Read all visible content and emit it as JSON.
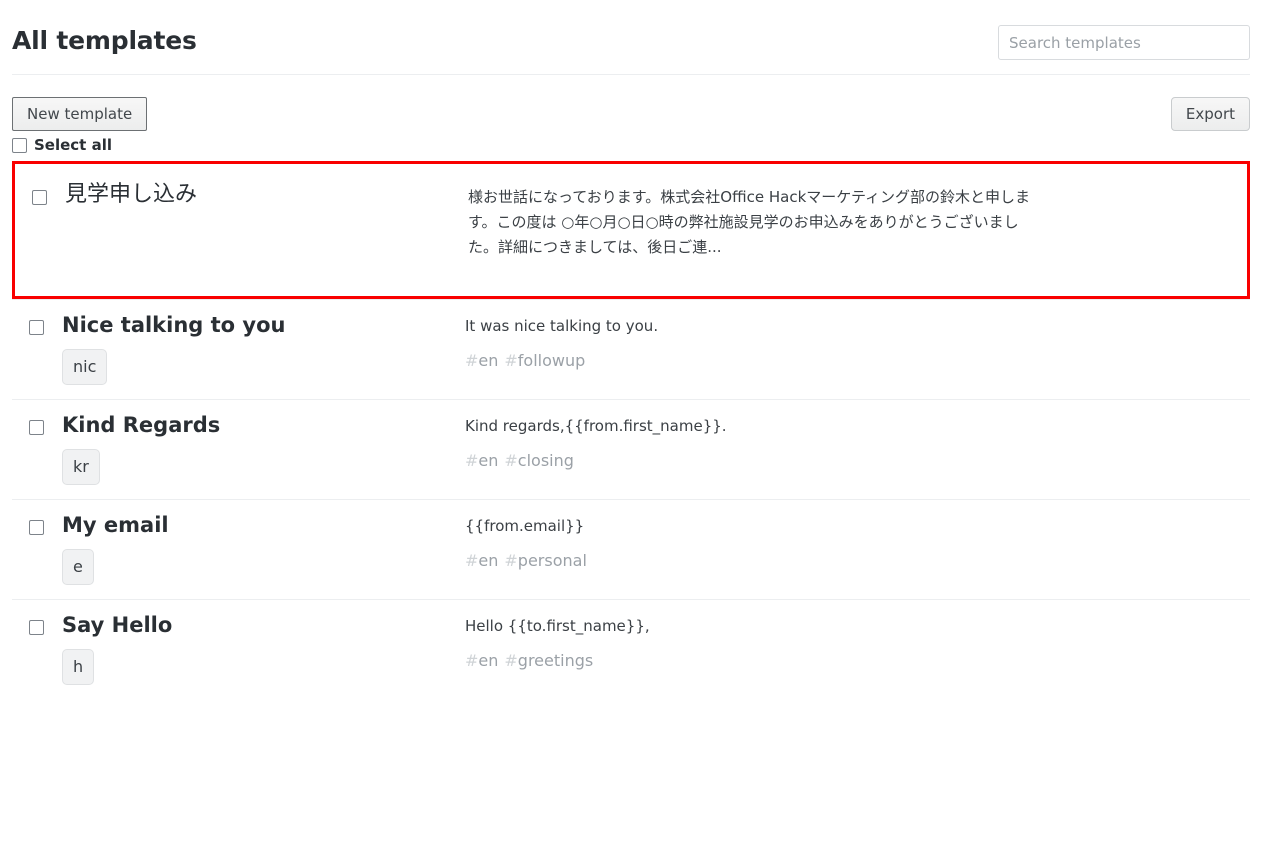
{
  "header": {
    "title": "All templates",
    "search_placeholder": "Search templates",
    "search_value": ""
  },
  "toolbar": {
    "new_template_label": "New template",
    "export_label": "Export"
  },
  "select_all": {
    "label": "Select all",
    "checked": false
  },
  "templates": [
    {
      "name": "見学申し込み",
      "shortcut": "",
      "body": "様お世話になっております。株式会社Office Hackマーケティング部の鈴木と申します。この度は ○年○月○日○時の弊社施設見学のお申込みをありがとうございました。詳細につきましては、後日ご連...",
      "tags": [],
      "checked": false,
      "highlighted": true
    },
    {
      "name": "Nice talking to you",
      "shortcut": "nic",
      "body": "It was nice talking to you.",
      "tags": [
        "en",
        "followup"
      ],
      "checked": false,
      "highlighted": false
    },
    {
      "name": "Kind Regards",
      "shortcut": "kr",
      "body": "Kind regards,{{from.first_name}}.",
      "tags": [
        "en",
        "closing"
      ],
      "checked": false,
      "highlighted": false
    },
    {
      "name": "My email",
      "shortcut": "e",
      "body": "{{from.email}}",
      "tags": [
        "en",
        "personal"
      ],
      "checked": false,
      "highlighted": false
    },
    {
      "name": "Say Hello",
      "shortcut": "h",
      "body": "Hello {{to.first_name}},",
      "tags": [
        "en",
        "greetings"
      ],
      "checked": false,
      "highlighted": false
    }
  ],
  "colors": {
    "highlight_border": "#f90000",
    "text_primary": "#2a2f34",
    "text_secondary": "#3b4045",
    "tag": "#9ba1a7",
    "divider": "#eceef0"
  }
}
